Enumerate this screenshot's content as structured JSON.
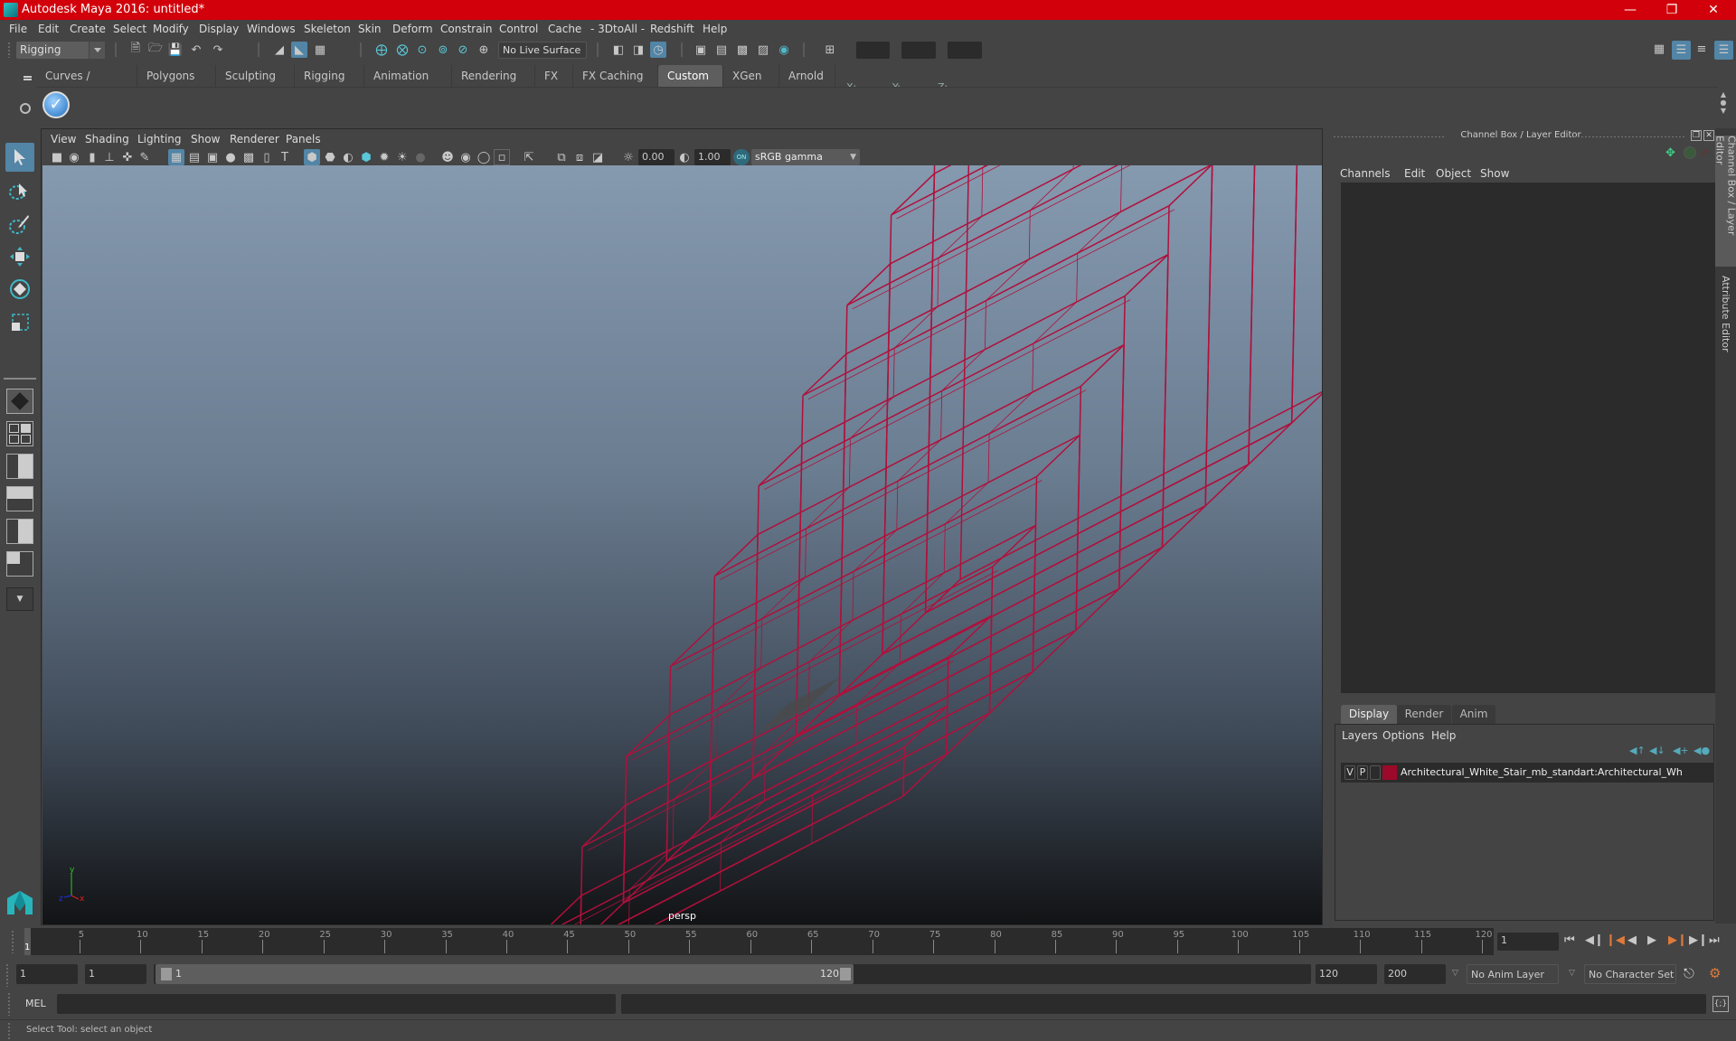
{
  "window": {
    "title": "Autodesk Maya 2016: untitled*",
    "controls": [
      "minimize",
      "restore",
      "close"
    ]
  },
  "menubar": {
    "items": [
      "File",
      "Edit",
      "Create",
      "Select",
      "Modify",
      "Display",
      "Windows",
      "Skeleton",
      "Skin",
      "Deform",
      "Constrain",
      "Control",
      "Cache",
      "- 3DtoAll -",
      "Redshift",
      "Help"
    ]
  },
  "statusline": {
    "mode": "Rigging",
    "live_surface": "No Live Surface",
    "x_label": "X:",
    "y_label": "Y:",
    "z_label": "Z:",
    "x_value": "",
    "y_value": "",
    "z_value": ""
  },
  "shelf": {
    "tabs": [
      "Curves / Surfaces",
      "Polygons",
      "Sculpting",
      "Rigging",
      "Animation",
      "Rendering",
      "FX",
      "FX Caching",
      "Custom",
      "XGen",
      "Arnold"
    ],
    "active_tab": "Custom"
  },
  "viewport": {
    "menu": [
      "View",
      "Shading",
      "Lighting",
      "Show",
      "Renderer",
      "Panels"
    ],
    "exposure": "0.00",
    "gamma": "1.00",
    "color_space": "sRGB gamma",
    "camera_label": "persp",
    "axis_labels": {
      "y": "y",
      "x": "x",
      "z": "z"
    },
    "wire_color": "#b0103c"
  },
  "channel_box": {
    "title": "Channel Box / Layer Editor",
    "menu": [
      "Channels",
      "Edit",
      "Object",
      "Show"
    ]
  },
  "layer_editor": {
    "tabs": [
      "Display",
      "Render",
      "Anim"
    ],
    "active_tab": "Display",
    "menu": [
      "Layers",
      "Options",
      "Help"
    ],
    "layers": [
      {
        "visible": "V",
        "playback": "P",
        "color": "#9b0a2a",
        "name": "Architectural_White_Stair_mb_standart:Architectural_Wh"
      }
    ]
  },
  "side_tabs": [
    "Channel Box / Layer Editor",
    "Attribute Editor"
  ],
  "timeline": {
    "ticks": [
      5,
      10,
      15,
      20,
      25,
      30,
      35,
      40,
      45,
      50,
      55,
      60,
      65,
      70,
      75,
      80,
      85,
      90,
      95,
      100,
      105,
      110,
      115,
      120
    ],
    "current_frame_marker": "1",
    "current_frame": "1"
  },
  "range": {
    "start": "1",
    "playback_start": "1",
    "slider_start": "1",
    "slider_end": "120",
    "playback_end": "120",
    "end": "200",
    "anim_layer": "No Anim Layer",
    "character_set": "No Character Set"
  },
  "command_line": {
    "language": "MEL",
    "input": "",
    "result": ""
  },
  "help_line": "Select Tool: select an object"
}
